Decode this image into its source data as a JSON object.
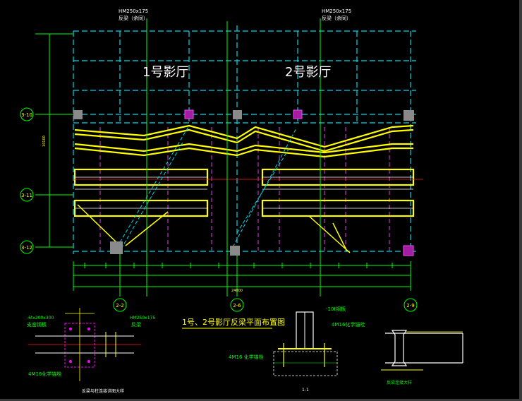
{
  "labels": {
    "hall1": "1号影厅",
    "hall2": "2号影厅",
    "beam_spec_left": "HM250x175",
    "beam_spec_left_note": "反梁（余同）",
    "beam_spec_right": "HM250x175",
    "beam_spec_right_note": "反梁（余同）",
    "plan_title": "1号、2号影厅反梁平面布置图",
    "detail_left_title": "反梁与柱连接详图大样",
    "detail_left_spec1": "-6tx200x300",
    "detail_left_spec2": "支座钢板",
    "detail_left_spec3": "HM250x175",
    "detail_left_spec4": "反梁",
    "detail_left_spec5": "4M16化学锚栓",
    "detail_mid_spec1": "-10t钢板",
    "detail_mid_spec2": "4M16化学锚栓",
    "detail_mid_spec3": "4M16 化学锚栓",
    "detail_mid_title": "1-1",
    "detail_right_title": "反梁连接大样",
    "axis_3_10": "3-10",
    "axis_3_11": "3-11",
    "axis_3_12": "3-12",
    "axis_2_2": "2-2",
    "axis_2_6": "2-6",
    "axis_2_9": "2-9",
    "dim_total": "24000",
    "dim_left_total": "10100"
  },
  "colors": {
    "background": "#000000",
    "cyan": "#00d8e8",
    "yellow": "#ffff00",
    "white": "#ffffff",
    "green": "#00ff00",
    "magenta": "#ff00ff",
    "red": "#ff2020",
    "gray": "#8a8a8a"
  }
}
